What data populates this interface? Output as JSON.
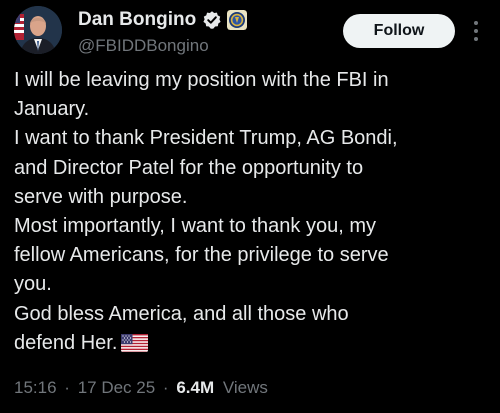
{
  "author": {
    "display_name": "Dan Bongino",
    "handle": "@FBIDDBongino",
    "avatar_icon": "profile-photo-icon",
    "verified_icon": "verified-badge-icon",
    "affiliation_icon": "fbi-seal-icon"
  },
  "actions": {
    "follow_label": "Follow",
    "more_icon": "more-vertical-icon"
  },
  "tweet": {
    "lines": [
      "I will be leaving my position with the FBI in",
      "January.",
      "I want to thank President Trump, AG Bondi,",
      "and Director Patel for the opportunity to",
      "serve with purpose.",
      "Most importantly, I want to thank you, my",
      "fellow Americans, for the privilege to serve",
      "you.",
      "God bless America, and all those who",
      "defend Her."
    ],
    "emoji": "us-flag-emoji"
  },
  "meta": {
    "time": "15:16",
    "date": "17 Dec 25",
    "separator": "·",
    "views_count": "6.4M",
    "views_label": "Views"
  },
  "colors": {
    "background": "#000000",
    "text_primary": "#e7e9ea",
    "text_secondary": "#71767b",
    "verified_blue": "#1d9bf0",
    "follow_bg": "#eff3f4",
    "follow_text": "#0f1419"
  }
}
